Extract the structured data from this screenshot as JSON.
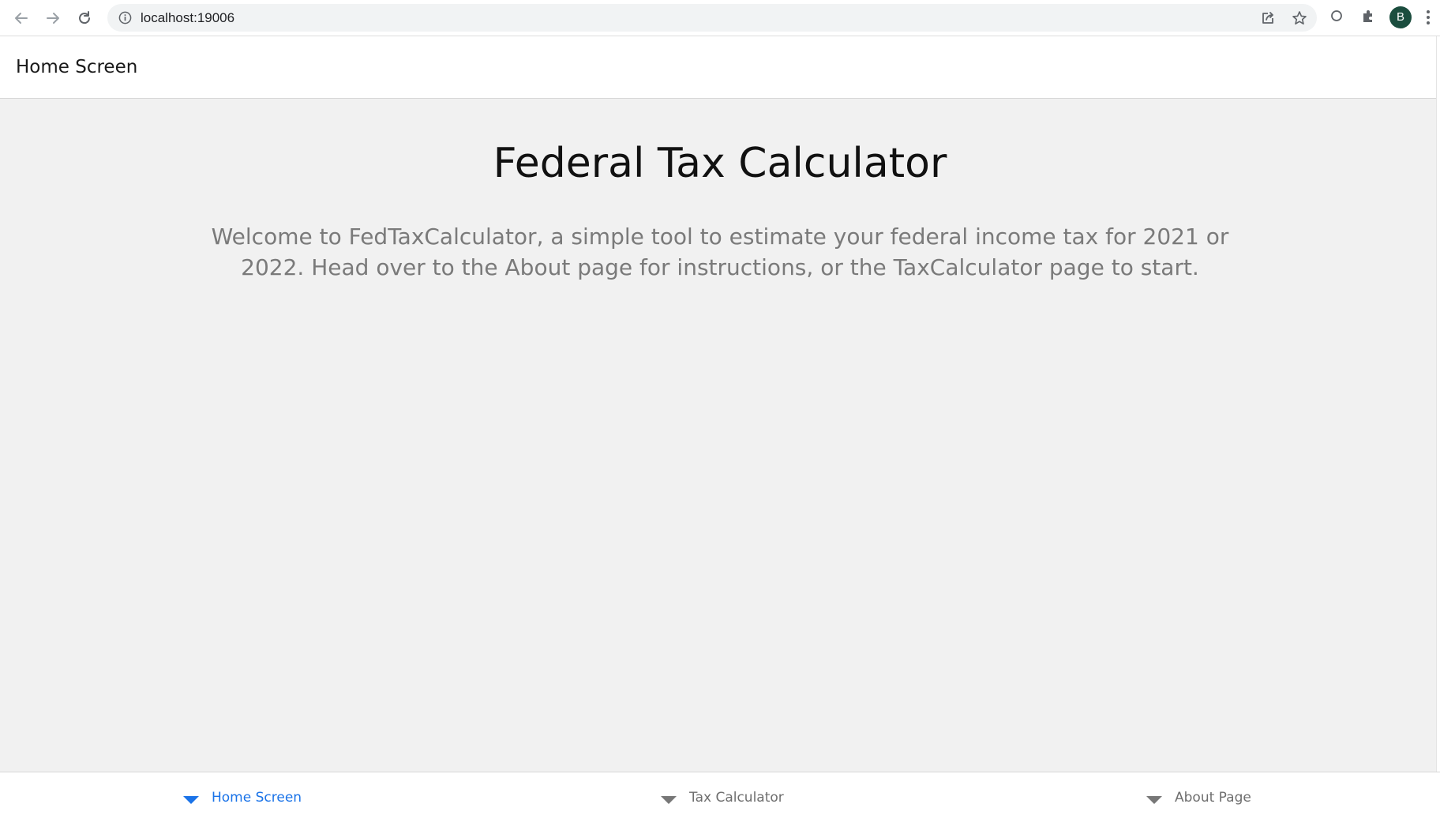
{
  "browser": {
    "url": "localhost:19006",
    "profile_initial": "B",
    "accent": "#1a73e8"
  },
  "header": {
    "title": "Home Screen"
  },
  "main": {
    "title": "Federal Tax Calculator",
    "intro": "Welcome to FedTaxCalculator, a simple tool to estimate your federal income tax for 2021 or 2022. Head over to the About page for instructions, or the TaxCalculator page to start."
  },
  "tabs": [
    {
      "label": "Home Screen",
      "icon": "chevron-down-icon",
      "active": true
    },
    {
      "label": "Tax Calculator",
      "icon": "chevron-down-icon",
      "active": false
    },
    {
      "label": "About Page",
      "icon": "chevron-down-icon",
      "active": false
    }
  ]
}
